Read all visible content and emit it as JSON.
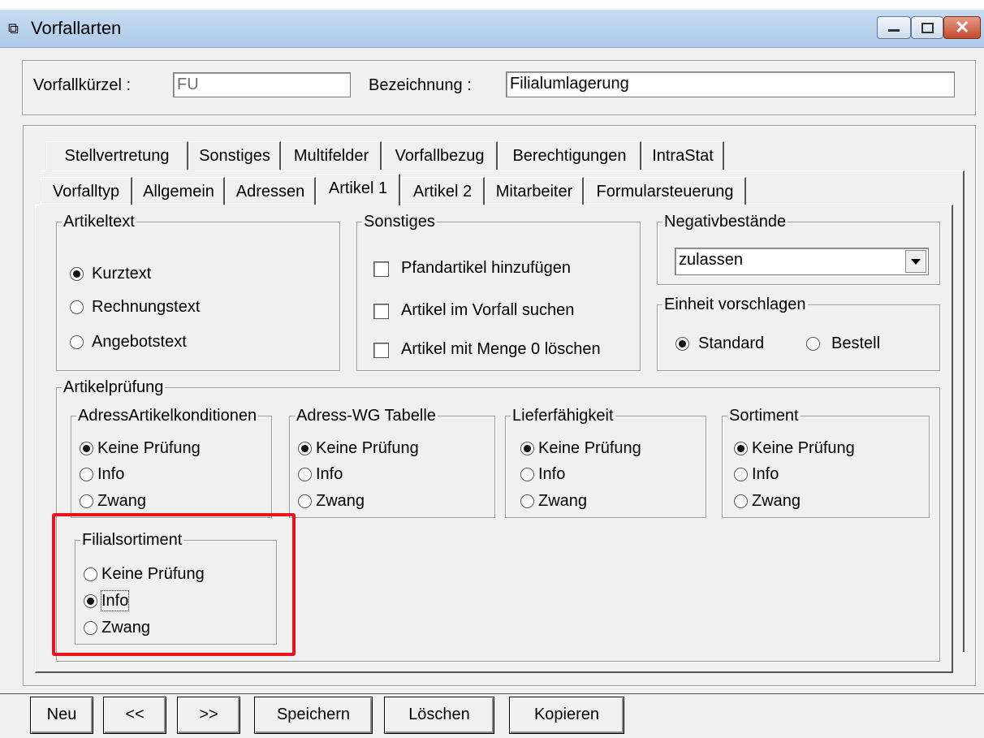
{
  "window": {
    "title": "Vorfallarten"
  },
  "header": {
    "kuerzel_label": "Vorfallkürzel :",
    "kuerzel_value": "FU",
    "bezeichnung_label": "Bezeichnung :",
    "bezeichnung_value": "Filialumlagerung"
  },
  "tabs": {
    "row1": [
      {
        "label": "Stellvertretung",
        "key": "S"
      },
      {
        "label": "Sonstiges",
        "key": ""
      },
      {
        "label": "Multifelder",
        "key": "u"
      },
      {
        "label": "Vorfallbezug",
        "key": ""
      },
      {
        "label": "Berechtigungen",
        "key": ""
      },
      {
        "label": "IntraStat",
        "key": "I"
      }
    ],
    "row2": [
      {
        "label": "Vorfalltyp",
        "key": ""
      },
      {
        "label": "Allgemein",
        "key": ""
      },
      {
        "label": "Adressen",
        "key": "A"
      },
      {
        "label": "Artikel 1",
        "key": "r",
        "active": true
      },
      {
        "label": "Artikel 2",
        "key": "2"
      },
      {
        "label": "Mitarbeiter",
        "key": "M"
      },
      {
        "label": "Formularsteuerung",
        "key": "F"
      }
    ]
  },
  "artikeltext": {
    "title": "Artikeltext",
    "options": [
      "Kurztext",
      "Rechnungstext",
      "Angebotstext"
    ],
    "selected": 0
  },
  "sonstiges": {
    "title": "Sonstiges",
    "checks": [
      "Pfandartikel hinzufügen",
      "Artikel im Vorfall suchen",
      "Artikel mit Menge 0 löschen"
    ]
  },
  "negativ": {
    "title": "Negativbestände",
    "value": "zulassen"
  },
  "einheit": {
    "title": "Einheit vorschlagen",
    "options": [
      "Standard",
      "Bestell"
    ],
    "selected": 0
  },
  "pruefung": {
    "title": "Artikelprüfung",
    "groups": [
      {
        "title": "AdressArtikelkonditionen",
        "options": [
          "Keine Prüfung",
          "Info",
          "Zwang"
        ],
        "selected": 0
      },
      {
        "title": "Adress-WG Tabelle",
        "options": [
          "Keine Prüfung",
          "Info",
          "Zwang"
        ],
        "selected": 0
      },
      {
        "title": "Lieferfähigkeit",
        "options": [
          "Keine Prüfung",
          "Info",
          "Zwang"
        ],
        "selected": 0
      },
      {
        "title": "Sortiment",
        "options": [
          "Keine Prüfung",
          "Info",
          "Zwang"
        ],
        "selected": 0
      },
      {
        "title": "Filialsortiment",
        "options": [
          "Keine Prüfung",
          "Info",
          "Zwang"
        ],
        "selected": 1
      }
    ]
  },
  "buttons": [
    "Neu",
    "<<",
    ">>",
    "Speichern",
    "Löschen",
    "Kopieren"
  ],
  "colors": {
    "highlight": "#e8141b",
    "titlebar": "#b9d1ea"
  }
}
